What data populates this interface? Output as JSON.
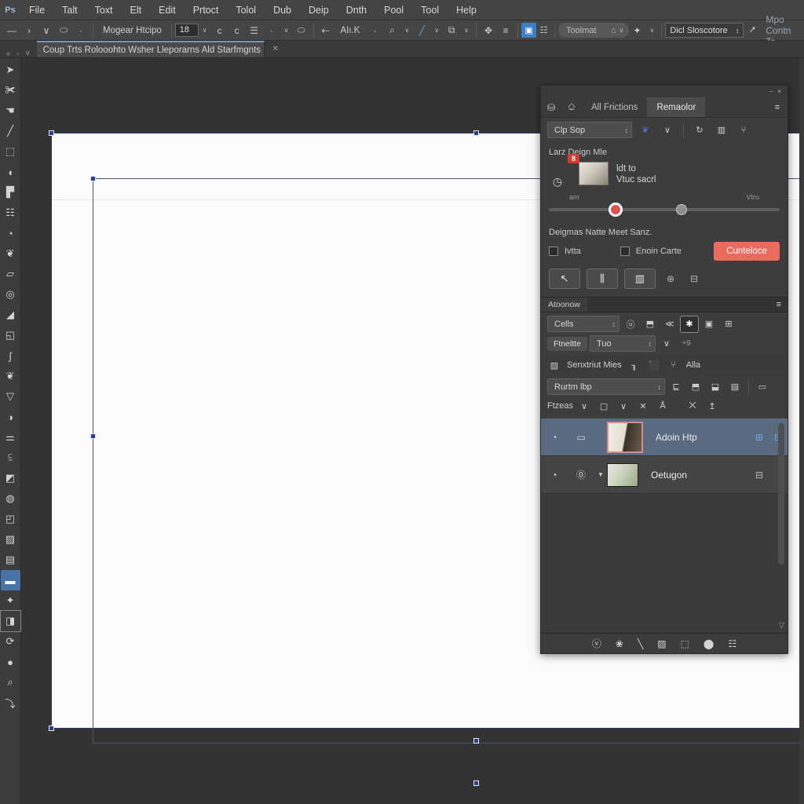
{
  "app": {
    "logo": "Ps",
    "accent_blue": "#3d7fc4",
    "accent_red": "#ea6a5e",
    "panel_bg": "#3d3d3d",
    "toolbar_bg": "#3c3c3c",
    "selection_blue": "#2c3e8f"
  },
  "menubar": {
    "items": [
      {
        "label": "File"
      },
      {
        "label": "Talt"
      },
      {
        "label": "Toxt"
      },
      {
        "label": "Elt"
      },
      {
        "label": "Edit"
      },
      {
        "label": "Prtoct"
      },
      {
        "label": "Tolol"
      },
      {
        "label": "Dub"
      },
      {
        "label": "Deip"
      },
      {
        "label": "Dnth"
      },
      {
        "label": "Pool"
      },
      {
        "label": "Tool"
      },
      {
        "label": "Help"
      }
    ]
  },
  "optionsbar": {
    "home_icon": "—",
    "forward_icon": "›",
    "caret_icon": "∨",
    "lasso_icon": "⬭",
    "dot_icon": "·",
    "mode_label": "Mogear Htcipo",
    "feather_value": "18",
    "feather_caret": "∨",
    "align_icon_1": "c",
    "align_icon_2": "c",
    "align_icon_3": "☰",
    "small_dot": "·",
    "balloon_icon": "⬭",
    "arrow_icon": "⇠",
    "anti_alias_label": "AIı.K",
    "zoom_icon": "⌕",
    "brush_icon": "╱",
    "frame_icon": "⧉",
    "move_icon": "✥",
    "align_icon": "≡",
    "grid_icon_a": "▣",
    "grid_icon_b": "☷",
    "search_field_value": "Toolmat",
    "search_bell_icon": "⌂",
    "search_caret": "∨",
    "magic_icon": "✦",
    "workspace_value": "Dicl Sloscotore",
    "workspace_stepper": "↕",
    "share_icon": "⭧",
    "share_label": "Mpo Contn Tc"
  },
  "tabbar": {
    "arrow_left": "«",
    "arrow_right": "›",
    "arrow_down": "∨",
    "doc_title": "Coup Trts Rolooohto Wsher Lleporarns Ald Starfmgnts",
    "doc_caret": "∨",
    "extra": "✕"
  },
  "toolbar": {
    "tools": [
      {
        "name": "move-tool",
        "icon": "➤",
        "state": "normal"
      },
      {
        "name": "artboard-tool",
        "icon": "✀",
        "state": "normal"
      },
      {
        "name": "lasso-tool",
        "icon": "☚",
        "state": "normal"
      },
      {
        "name": "line-tool",
        "icon": "╱",
        "state": "normal"
      },
      {
        "name": "crop-tool",
        "icon": "⬚",
        "state": "normal"
      },
      {
        "name": "eyedropper-tool",
        "icon": "◖",
        "state": "normal"
      },
      {
        "name": "healing-tool",
        "icon": "▛",
        "state": "normal"
      },
      {
        "name": "frame-tool",
        "icon": "☷",
        "state": "normal"
      },
      {
        "name": "brush-tool",
        "icon": "◔",
        "state": "normal"
      },
      {
        "name": "clone-stamp-tool",
        "icon": "❦",
        "state": "normal"
      },
      {
        "name": "eraser-tool",
        "icon": "▱",
        "state": "normal"
      },
      {
        "name": "blur-tool",
        "icon": "◎",
        "state": "normal"
      },
      {
        "name": "dodge-tool",
        "icon": "◢",
        "state": "normal"
      },
      {
        "name": "pen-tool",
        "icon": "◱",
        "state": "normal"
      },
      {
        "name": "type-tool",
        "icon": "∫",
        "state": "normal"
      },
      {
        "name": "path-tool",
        "icon": "❦",
        "state": "normal"
      },
      {
        "name": "shape-tool",
        "icon": "▽",
        "state": "normal"
      },
      {
        "name": "curve-tool",
        "icon": "◑",
        "state": "normal"
      },
      {
        "name": "measure-tool",
        "icon": "⚌",
        "state": "normal"
      },
      {
        "name": "history-brush-tool",
        "icon": "⫉",
        "state": "normal"
      },
      {
        "name": "gradient-tool",
        "icon": "◩",
        "state": "normal"
      },
      {
        "name": "smudge-tool",
        "icon": "◍",
        "state": "normal"
      },
      {
        "name": "sharpen-tool",
        "icon": "◰",
        "state": "normal"
      },
      {
        "name": "mask-tool",
        "icon": "▨",
        "state": "normal"
      },
      {
        "name": "note-tool",
        "icon": "▤",
        "state": "normal"
      },
      {
        "name": "screen-mode-tool",
        "icon": "▬",
        "state": "selected"
      },
      {
        "name": "hand-tool",
        "icon": "✦",
        "state": "normal"
      },
      {
        "name": "quick-mask-tool",
        "icon": "◨",
        "state": "boxed"
      },
      {
        "name": "rotate-tool",
        "icon": "⟳",
        "state": "normal"
      },
      {
        "name": "color-picker-tool",
        "icon": "●",
        "state": "normal"
      },
      {
        "name": "zoom-tool",
        "icon": "⌕",
        "state": "normal"
      },
      {
        "name": "more-tools",
        "icon": "⤵",
        "state": "normal"
      }
    ]
  },
  "canvas": {
    "handles_label": "selection-handle"
  },
  "panel_top": {
    "collapse_icon": "–",
    "close_icon": "×",
    "tab_icon_1": "⛁",
    "tab_icon_2": "⎐",
    "tabs": [
      {
        "label": "All Frictions",
        "active": false
      },
      {
        "label": "Remaolor",
        "active": true
      }
    ],
    "menu_icon": "≡",
    "preset_value": "Clp Sop",
    "preset_stepper": "↕",
    "swatch_icon": "❦",
    "swatch_caret": "∨",
    "ic_rotate": "↻",
    "ic_split": "▥",
    "ic_merge": "⑂",
    "section_label": "Larz Deign   Mle",
    "clock_icon": "◷",
    "badge": "8",
    "thumb_line1": "ldt to",
    "thumb_line2": "Vtuc sacrl",
    "tick_left": "am",
    "tick_right": "Vtru",
    "desc_label": "Deigmas Natte Meet Sanz.",
    "checkbox_1_label": "Ivtta",
    "checkbox_2_label": "Enoin Carte",
    "primary_button": "Cunteloce",
    "btn_1_icon": "↖",
    "btn_2_icon": "⫼",
    "btn_3_icon": "▥",
    "ic_target": "⊕",
    "ic_layers": "⊟"
  },
  "panel_mid": {
    "title": "Atoonow",
    "menu_icon": "≡",
    "select_value": "Cells",
    "select_stepper": "↕",
    "icons": [
      {
        "name": "rotate-icon",
        "glyph": "ⓤ",
        "active": false
      },
      {
        "name": "align-icon",
        "glyph": "⬒",
        "active": false
      },
      {
        "name": "flip-icon",
        "glyph": "≪",
        "active": false
      },
      {
        "name": "person-icon",
        "glyph": "✱",
        "active": true
      },
      {
        "name": "comment-icon",
        "glyph": "▣",
        "active": false
      },
      {
        "name": "frame-icon",
        "glyph": "⊞",
        "active": false
      }
    ],
    "pill_label": "Ftneltte",
    "field_value": "Tuo",
    "field_stepper": "↕",
    "caret": "∨",
    "trailing": "+9"
  },
  "panel_layers": {
    "head_icon": "▨",
    "head_label": "Senxtriut Mies",
    "head_ic_1": "┒",
    "head_ic_2": "⬛",
    "head_ic_3": "⑂",
    "head_ic_4": "Alla",
    "blend_value": "Rurtm lbp",
    "blend_stepper": "↕",
    "blend_icons": [
      "⊑",
      "⬒",
      "⬓",
      "▤",
      "▭"
    ],
    "filter_label": "Ftzeas",
    "filter_caret": "∨",
    "filter_box": "▢",
    "filter_box_caret": "∨",
    "filter_x": "✕",
    "filter_a": "Å",
    "filter_mix": "⨉",
    "filter_sort": "↥",
    "rows": [
      {
        "name": "Adoin Htp",
        "visibility_icon": "◔",
        "lock_icon": "▭",
        "caret": "",
        "thumb_style": "outlined",
        "trailing_icons": [
          "⊞",
          "⊟"
        ],
        "selected": true
      },
      {
        "name": "Oetugon",
        "visibility_icon": "◔",
        "lock_icon": "⓪",
        "caret": "▼",
        "thumb_style": "small",
        "trailing_icons": [
          "⊟"
        ],
        "selected": false
      }
    ],
    "scroll_down_icon": "▽",
    "footer_icons": [
      {
        "name": "link-layers-icon",
        "glyph": "ⓥ"
      },
      {
        "name": "add-style-icon",
        "glyph": "❀"
      },
      {
        "name": "add-mask-icon",
        "glyph": "╲"
      },
      {
        "name": "adjustment-icon",
        "glyph": "▨"
      },
      {
        "name": "new-group-icon",
        "glyph": "⬚"
      },
      {
        "name": "new-layer-icon",
        "glyph": "⬤"
      },
      {
        "name": "delete-layer-icon",
        "glyph": "☷"
      }
    ]
  }
}
